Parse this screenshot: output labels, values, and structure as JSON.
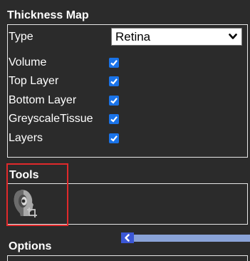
{
  "thickness_map": {
    "title": "Thickness Map",
    "type_label": "Type",
    "type_value": "Retina",
    "rows": [
      {
        "label": "Volume",
        "checked": true
      },
      {
        "label": "Top Layer",
        "checked": true
      },
      {
        "label": "Bottom Layer",
        "checked": true
      },
      {
        "label": "GreyscaleTissue",
        "checked": true
      },
      {
        "label": "Layers",
        "checked": true
      }
    ]
  },
  "tools": {
    "title": "Tools",
    "items": [
      {
        "icon": "retina-crop-tool-icon"
      }
    ]
  },
  "options": {
    "title": "Options"
  },
  "colors": {
    "background": "#2b2b2b",
    "checkbox": "#1a73e8",
    "highlight": "#e0292b",
    "scroll_button": "#3b57d6",
    "scroll_track": "#8aa3d8"
  }
}
